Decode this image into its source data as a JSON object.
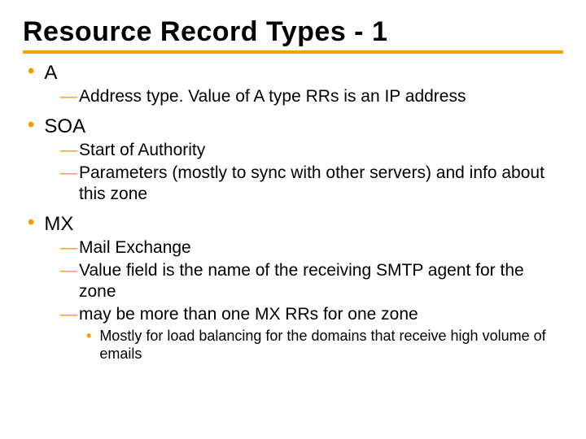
{
  "title": "Resource Record Types - 1",
  "sections": [
    {
      "name": "A",
      "subs": [
        {
          "text": "Address type. Value of A type RRs is an IP address"
        }
      ]
    },
    {
      "name": "SOA",
      "subs": [
        {
          "text": "Start of Authority"
        },
        {
          "text": "Parameters (mostly to sync with other servers) and info about this zone"
        }
      ]
    },
    {
      "name": "MX",
      "subs": [
        {
          "text": "Mail Exchange"
        },
        {
          "text": "Value field is the name of the receiving SMTP agent for the zone"
        },
        {
          "text": "may be more than one MX RRs for one zone",
          "subsubs": [
            {
              "text": "Mostly for load balancing for the domains that receive high volume of emails"
            }
          ]
        }
      ]
    }
  ]
}
